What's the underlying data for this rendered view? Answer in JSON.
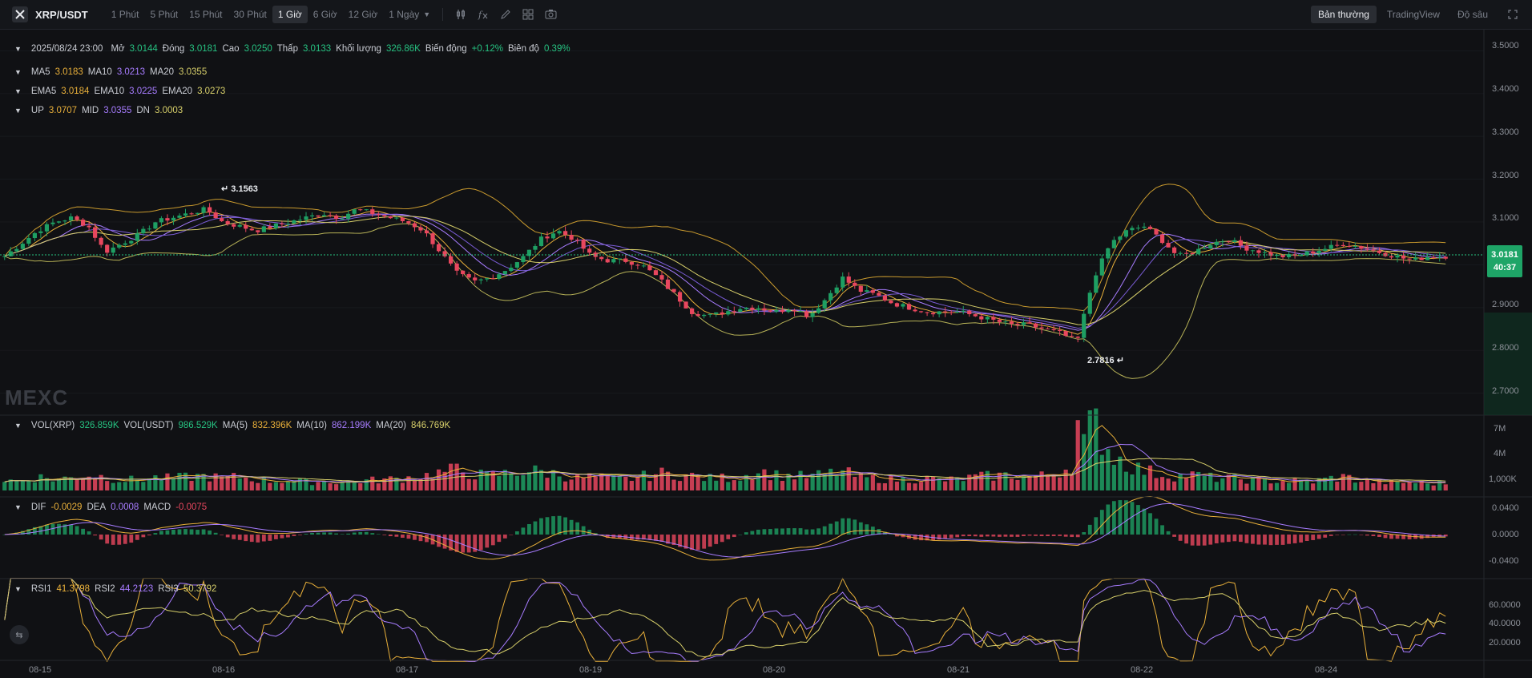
{
  "header": {
    "pair": "XRP/USDT",
    "intervals": [
      "1 Phút",
      "5 Phút",
      "15 Phút",
      "30 Phút",
      "1 Giờ",
      "6 Giờ",
      "12 Giờ"
    ],
    "active_interval": "1 Giờ",
    "more_interval": "1 Ngày",
    "views": [
      "Bản thường",
      "TradingView",
      "Độ sâu"
    ],
    "active_view": "Bản thường"
  },
  "ohlc": {
    "date": "2025/08/24 23:00",
    "open_label": "Mở",
    "open": "3.0144",
    "close_label": "Đóng",
    "close": "3.0181",
    "high_label": "Cao",
    "high": "3.0250",
    "low_label": "Thấp",
    "low": "3.0133",
    "vol_label": "Khối lượng",
    "vol": "326.86K",
    "chg_label": "Biến động",
    "chg": "+0.12%",
    "amp_label": "Biên độ",
    "amp": "0.39%"
  },
  "ma": {
    "ma5_label": "MA5",
    "ma5": "3.0183",
    "ma10_label": "MA10",
    "ma10": "3.0213",
    "ma20_label": "MA20",
    "ma20": "3.0355"
  },
  "ema": {
    "ema5_label": "EMA5",
    "ema5": "3.0184",
    "ema10_label": "EMA10",
    "ema10": "3.0225",
    "ema20_label": "EMA20",
    "ema20": "3.0273"
  },
  "boll": {
    "up_label": "UP",
    "up": "3.0707",
    "mid_label": "MID",
    "mid": "3.0355",
    "dn_label": "DN",
    "dn": "3.0003"
  },
  "vol_legend": {
    "vxrp_label": "VOL(XRP)",
    "vxrp": "326.859K",
    "vusdt_label": "VOL(USDT)",
    "vusdt": "986.529K",
    "ma5_label": "MA(5)",
    "ma5": "832.396K",
    "ma10_label": "MA(10)",
    "ma10": "862.199K",
    "ma20_label": "MA(20)",
    "ma20": "846.769K"
  },
  "macd_legend": {
    "dif_label": "DIF",
    "dif": "-0.0029",
    "dea_label": "DEA",
    "dea": "0.0008",
    "macd_label": "MACD",
    "macd": "-0.0075"
  },
  "rsi_legend": {
    "r1_label": "RSI1",
    "r1": "41.3798",
    "r2_label": "RSI2",
    "r2": "44.2123",
    "r3_label": "RSI3",
    "r3": "50.3792"
  },
  "price_axis": [
    "3.5000",
    "3.4000",
    "3.3000",
    "3.2000",
    "3.1000",
    "3.0000",
    "2.9000",
    "2.8000",
    "2.7000"
  ],
  "vol_axis": [
    "7M",
    "4M",
    "1,000K"
  ],
  "macd_axis": [
    "0.0400",
    "0.0000",
    "-0.0400"
  ],
  "rsi_axis": [
    "60.0000",
    "40.0000",
    "20.0000"
  ],
  "time_axis": [
    "08-15",
    "08-16",
    "08-17",
    "08-19",
    "08-20",
    "08-21",
    "08-22",
    "08-24"
  ],
  "last_price": "3.0181",
  "countdown": "40:37",
  "high_marker": "3.1563",
  "low_marker": "2.7816",
  "watermark": "MEXC",
  "colors": {
    "up": "#1e9f63",
    "down": "#e8475e",
    "ma5": "#e9b03a",
    "ma10": "#a77cff",
    "ma20": "#d7cf6a",
    "bg": "#101114"
  },
  "chart_data": {
    "type": "candlestick",
    "closes": [
      3.02,
      3.05,
      3.08,
      3.1,
      3.11,
      3.09,
      3.03,
      3.05,
      3.07,
      3.1,
      3.11,
      3.12,
      3.13,
      3.1,
      3.09,
      3.08,
      3.09,
      3.1,
      3.11,
      3.12,
      3.11,
      3.13,
      3.12,
      3.11,
      3.1,
      3.08,
      3.03,
      2.98,
      2.96,
      2.97,
      2.99,
      3.02,
      3.06,
      3.08,
      3.06,
      3.02,
      3.01,
      3.01,
      3.0,
      2.97,
      2.93,
      2.89,
      2.88,
      2.89,
      2.9,
      2.9,
      2.89,
      2.9,
      2.88,
      2.92,
      2.97,
      2.94,
      2.93,
      2.91,
      2.9,
      2.89,
      2.89,
      2.89,
      2.88,
      2.87,
      2.86,
      2.86,
      2.85,
      2.84,
      2.82,
      2.97,
      3.05,
      3.08,
      3.09,
      3.06,
      3.02,
      3.03,
      3.05,
      3.06,
      3.04,
      3.03,
      3.02,
      3.02,
      3.03,
      3.04,
      3.05,
      3.04,
      3.03,
      3.02,
      3.01,
      3.02,
      3.02
    ],
    "volume_m": [
      1.2,
      1.1,
      1.6,
      1.3,
      1.5,
      1.8,
      1.6,
      1.2,
      1.3,
      1.5,
      1.4,
      1.6,
      1.7,
      1.4,
      1.6,
      1.3,
      1.1,
      1.2,
      1.0,
      1.1,
      1.0,
      1.1,
      1.2,
      1.3,
      1.5,
      1.7,
      2.1,
      2.4,
      1.9,
      1.7,
      2.0,
      2.3,
      2.2,
      1.9,
      1.5,
      1.6,
      1.4,
      1.3,
      1.6,
      2.0,
      1.9,
      1.7,
      1.4,
      1.5,
      1.6,
      2.3,
      1.8,
      1.7,
      1.6,
      1.9,
      2.2,
      1.5,
      1.4,
      1.3,
      1.3,
      1.4,
      1.2,
      1.3,
      1.6,
      1.7,
      1.8,
      1.6,
      1.7,
      2.3,
      3.2,
      8.2,
      4.4,
      3.1,
      2.3,
      1.9,
      1.7,
      1.8,
      1.5,
      1.4,
      1.3,
      1.2,
      1.1,
      1.1,
      1.0,
      1.4,
      1.6,
      1.1,
      1.0,
      0.9,
      1.0,
      0.8,
      0.9
    ],
    "price_range": [
      2.66,
      3.54
    ],
    "x_labels": [
      "08-15",
      "08-16",
      "08-17",
      "08-19",
      "08-20",
      "08-21",
      "08-22",
      "08-24"
    ]
  }
}
